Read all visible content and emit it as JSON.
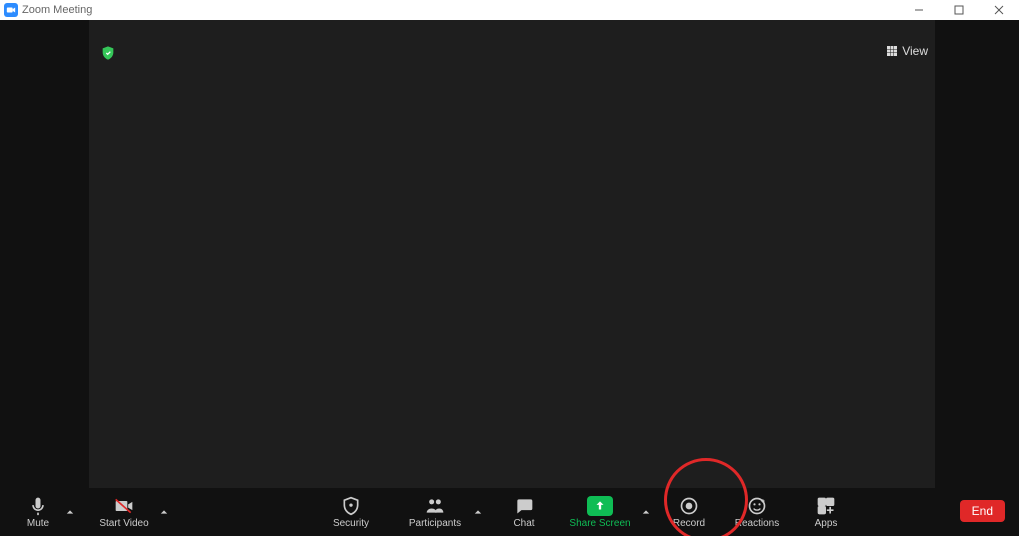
{
  "window": {
    "title": "Zoom Meeting"
  },
  "topbar": {
    "view_label": "View"
  },
  "toolbar": {
    "mute": "Mute",
    "start_video": "Start Video",
    "security": "Security",
    "participants": "Participants",
    "chat": "Chat",
    "share_screen": "Share Screen",
    "record": "Record",
    "reactions": "Reactions",
    "apps": "Apps",
    "end": "End"
  }
}
